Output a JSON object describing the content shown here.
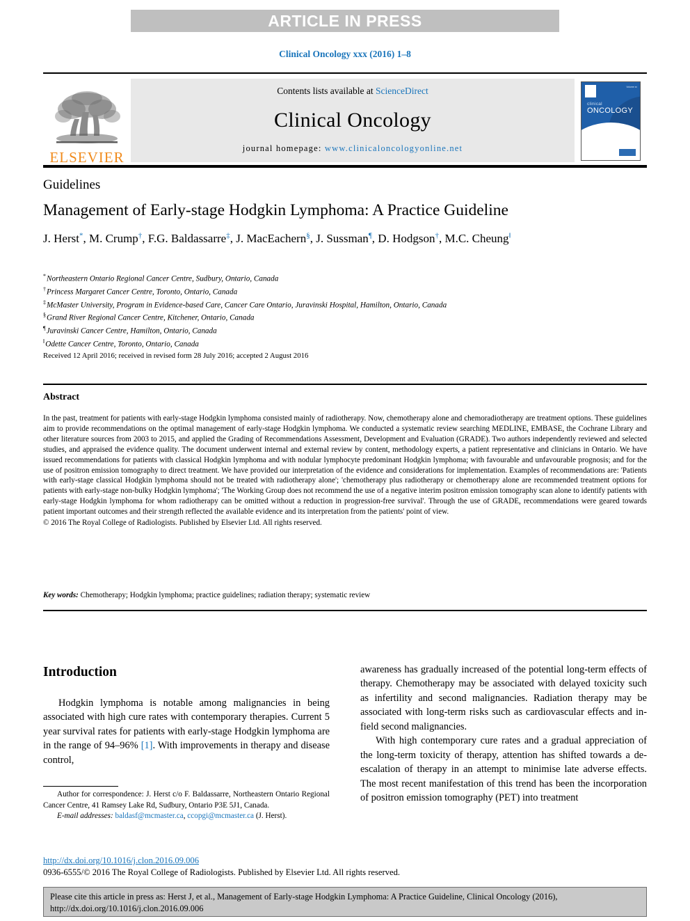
{
  "banner": {
    "text": "ARTICLE IN PRESS"
  },
  "journal_line": "Clinical Oncology xxx (2016) 1–8",
  "masthead": {
    "publisher": "ELSEVIER",
    "contents_prefix": "Contents lists available at ",
    "contents_link": "ScienceDirect",
    "journal_title": "Clinical Oncology",
    "homepage_prefix": "journal homepage: ",
    "homepage_url": "www.clinicaloncologyonline.net",
    "cover": {
      "top_text": "Volume xx",
      "line1": "clinical",
      "line2": "ONCOLOGY"
    }
  },
  "article": {
    "section_label": "Guidelines",
    "title": "Management of Early-stage Hodgkin Lymphoma: A Practice Guideline",
    "authors": [
      {
        "name": "J. Herst",
        "mark": "*"
      },
      {
        "name": "M. Crump",
        "mark": "†"
      },
      {
        "name": "F.G. Baldassarre",
        "mark": "‡"
      },
      {
        "name": "J. MacEachern",
        "mark": "§"
      },
      {
        "name": "J. Sussman",
        "mark": "¶"
      },
      {
        "name": "D. Hodgson",
        "mark": "†"
      },
      {
        "name": "M.C. Cheung",
        "mark": "‖"
      }
    ],
    "affiliations": [
      {
        "mark": "*",
        "text": "Northeastern Ontario Regional Cancer Centre, Sudbury, Ontario, Canada"
      },
      {
        "mark": "†",
        "text": "Princess Margaret Cancer Centre, Toronto, Ontario, Canada"
      },
      {
        "mark": "‡",
        "text": "McMaster University, Program in Evidence-based Care, Cancer Care Ontario, Juravinski Hospital, Hamilton, Ontario, Canada"
      },
      {
        "mark": "§",
        "text": "Grand River Regional Cancer Centre, Kitchener, Ontario, Canada"
      },
      {
        "mark": "¶",
        "text": "Juravinski Cancer Centre, Hamilton, Ontario, Canada"
      },
      {
        "mark": "‖",
        "text": "Odette Cancer Centre, Toronto, Ontario, Canada"
      }
    ],
    "history": "Received 12 April 2016; received in revised form 28 July 2016; accepted 2 August 2016"
  },
  "abstract": {
    "heading": "Abstract",
    "body": "In the past, treatment for patients with early-stage Hodgkin lymphoma consisted mainly of radiotherapy. Now, chemotherapy alone and chemoradiotherapy are treatment options. These guidelines aim to provide recommendations on the optimal management of early-stage Hodgkin lymphoma. We conducted a systematic review searching MEDLINE, EMBASE, the Cochrane Library and other literature sources from 2003 to 2015, and applied the Grading of Recommendations Assessment, Development and Evaluation (GRADE). Two authors independently reviewed and selected studies, and appraised the evidence quality. The document underwent internal and external review by content, methodology experts, a patient representative and clinicians in Ontario. We have issued recommendations for patients with classical Hodgkin lymphoma and with nodular lymphocyte predominant Hodgkin lymphoma; with favourable and unfavourable prognosis; and for the use of positron emission tomography to direct treatment. We have provided our interpretation of the evidence and considerations for implementation. Examples of recommendations are: 'Patients with early-stage classical Hodgkin lymphoma should not be treated with radiotherapy alone'; 'chemotherapy plus radiotherapy or chemotherapy alone are recommended treatment options for patients with early-stage non-bulky Hodgkin lymphoma'; 'The Working Group does not recommend the use of a negative interim positron emission tomography scan alone to identify patients with early-stage Hodgkin lymphoma for whom radiotherapy can be omitted without a reduction in progression-free survival'. Through the use of GRADE, recommendations were geared towards patient important outcomes and their strength reflected the available evidence and its interpretation from the patients' point of view.",
    "copyright": "© 2016 The Royal College of Radiologists. Published by Elsevier Ltd. All rights reserved.",
    "keywords_label": "Key words:",
    "keywords": "Chemotherapy; Hodgkin lymphoma; practice guidelines; radiation therapy; systematic review"
  },
  "body": {
    "intro_heading": "Introduction",
    "left_p1_a": "Hodgkin lymphoma is notable among malignancies in being associated with high cure rates with contemporary therapies. Current 5 year survival rates for patients with early-stage Hodgkin lymphoma are in the range of 94–96% ",
    "left_p1_ref": "[1]",
    "left_p1_b": ". With improvements in therapy and disease control,",
    "right_p1": "awareness has gradually increased of the potential long-term effects of therapy. Chemotherapy may be associated with delayed toxicity such as infertility and second malignancies. Radiation therapy may be associated with long-term risks such as cardiovascular effects and in-field second malignancies.",
    "right_p2": "With high contemporary cure rates and a gradual appreciation of the long-term toxicity of therapy, attention has shifted towards a de-escalation of therapy in an attempt to minimise late adverse effects. The most recent manifestation of this trend has been the incorporation of positron emission tomography (PET) into treatment"
  },
  "footnote": {
    "correspondence": "Author for correspondence: J. Herst c/o F. Baldassarre, Northeastern Ontario Regional Cancer Centre, 41 Ramsey Lake Rd, Sudbury, Ontario P3E 5J1, Canada.",
    "email_label": "E-mail addresses:",
    "email1": "baldasf@mcmaster.ca",
    "email2": "ccopgi@mcmaster.ca",
    "email_suffix": "(J. Herst).",
    "doi": "http://dx.doi.org/10.1016/j.clon.2016.09.006",
    "issn_copyright": "0936-6555/© 2016 The Royal College of Radiologists. Published by Elsevier Ltd. All rights reserved."
  },
  "cite_box": {
    "line1": "Please cite this article in press as: Herst J, et al., Management of Early-stage Hodgkin Lymphoma: A Practice Guideline, Clinical Oncology (2016),",
    "line2": "http://dx.doi.org/10.1016/j.clon.2016.09.006"
  },
  "colors": {
    "link_blue": "#1a75bb",
    "banner_gray": "#bfbfbf",
    "elsevier_orange": "#f08b1d",
    "cover_blue": "#1f5fa9",
    "cite_gray": "#c9c9c9"
  }
}
